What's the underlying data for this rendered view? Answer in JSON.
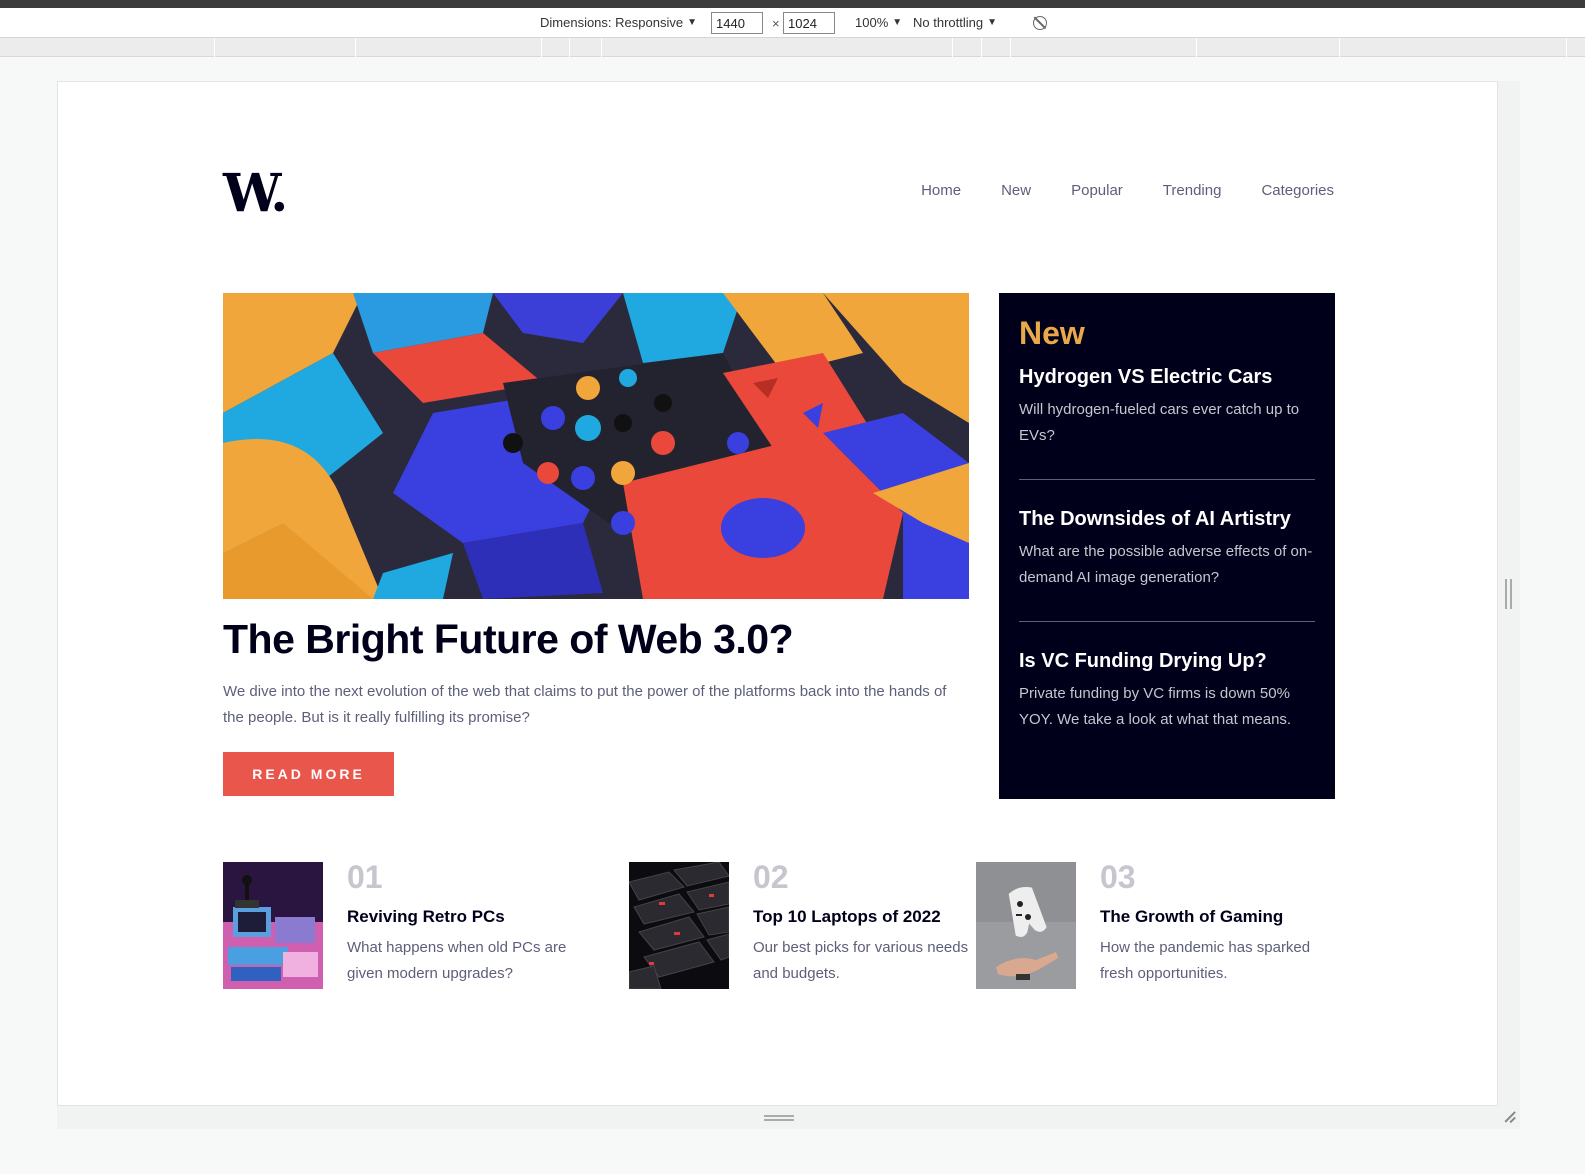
{
  "devtools": {
    "dimensions_label": "Dimensions: Responsive",
    "width": "1440",
    "height": "1024",
    "times": "×",
    "zoom": "100%",
    "throttling": "No throttling"
  },
  "site": {
    "logo": "W.",
    "nav": [
      "Home",
      "New",
      "Popular",
      "Trending",
      "Categories"
    ]
  },
  "hero": {
    "title": "The Bright Future of Web 3.0?",
    "description": "We dive into the next evolution of the web that claims to put the power of the platforms back into the hands of the people. But is it really fulfilling its promise?",
    "cta": "READ MORE"
  },
  "new_panel": {
    "heading": "New",
    "items": [
      {
        "title": "Hydrogen VS Electric Cars",
        "text": "Will hydrogen-fueled cars ever catch up to EVs?"
      },
      {
        "title": "The Downsides of AI Artistry",
        "text": "What are the possible adverse effects of on-demand AI image generation?"
      },
      {
        "title": "Is VC Funding Drying Up?",
        "text": "Private funding by VC firms is down 50% YOY. We take a look at what that means."
      }
    ]
  },
  "trending": [
    {
      "num": "01",
      "title": "Reviving Retro PCs",
      "text": "What happens when old PCs are given modern upgrades?"
    },
    {
      "num": "02",
      "title": "Top 10 Laptops of 2022",
      "text": "Our best picks for various needs and budgets."
    },
    {
      "num": "03",
      "title": "The Growth of Gaming",
      "text": "How the pandemic has sparked fresh opportunities."
    }
  ],
  "colors": {
    "accent": "#e9564c",
    "navy": "#00001a",
    "orange": "#e9a84a",
    "muted": "#5d5f79"
  }
}
